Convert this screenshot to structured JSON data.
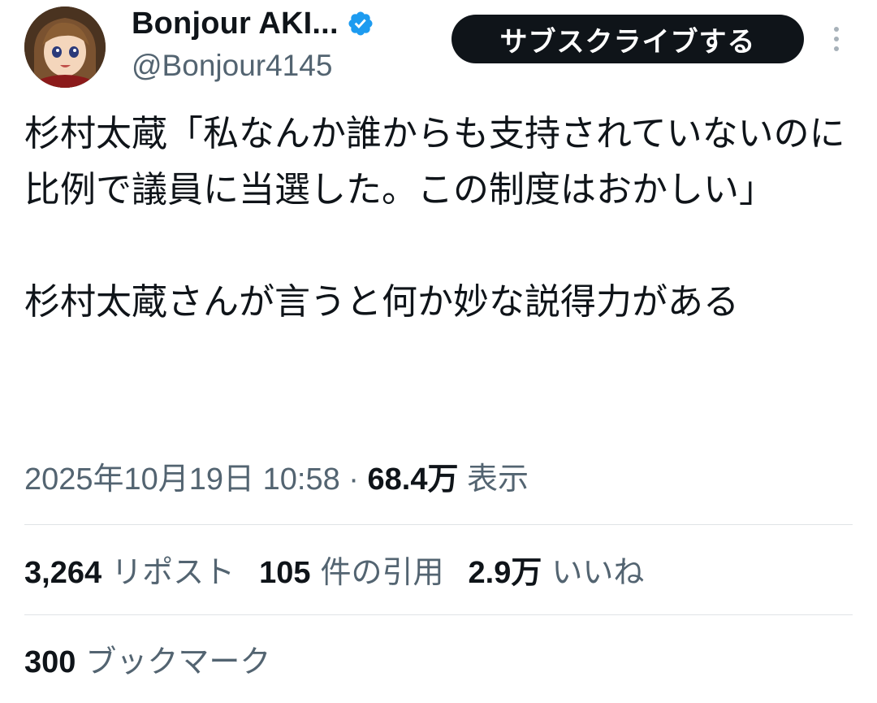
{
  "header": {
    "display_name": "Bonjour AKI...",
    "handle": "@Bonjour4145",
    "subscribe_label": "サブスクライブする",
    "verified_color": "#1d9bf0"
  },
  "tweet": {
    "text": "杉村太蔵「私なんか誰からも支持されていないのに比例で議員に当選した。この制度はおかしい」\n\n杉村太蔵さんが言うと何か妙な説得力がある",
    "timestamp": "2025年10月19日 10:58",
    "separator": " · ",
    "views_count": "68.4万",
    "views_label": "表示"
  },
  "stats": {
    "reposts": {
      "count": "3,264",
      "label": "リポスト"
    },
    "quotes": {
      "count": "105",
      "label": "件の引用"
    },
    "likes": {
      "count": "2.9万",
      "label": "いいね"
    },
    "bookmarks": {
      "count": "300",
      "label": "ブックマーク"
    }
  },
  "colors": {
    "text_primary": "#0f1419",
    "text_secondary": "#536471",
    "button_bg": "#0f1419",
    "divider": "#dfe3e6"
  }
}
